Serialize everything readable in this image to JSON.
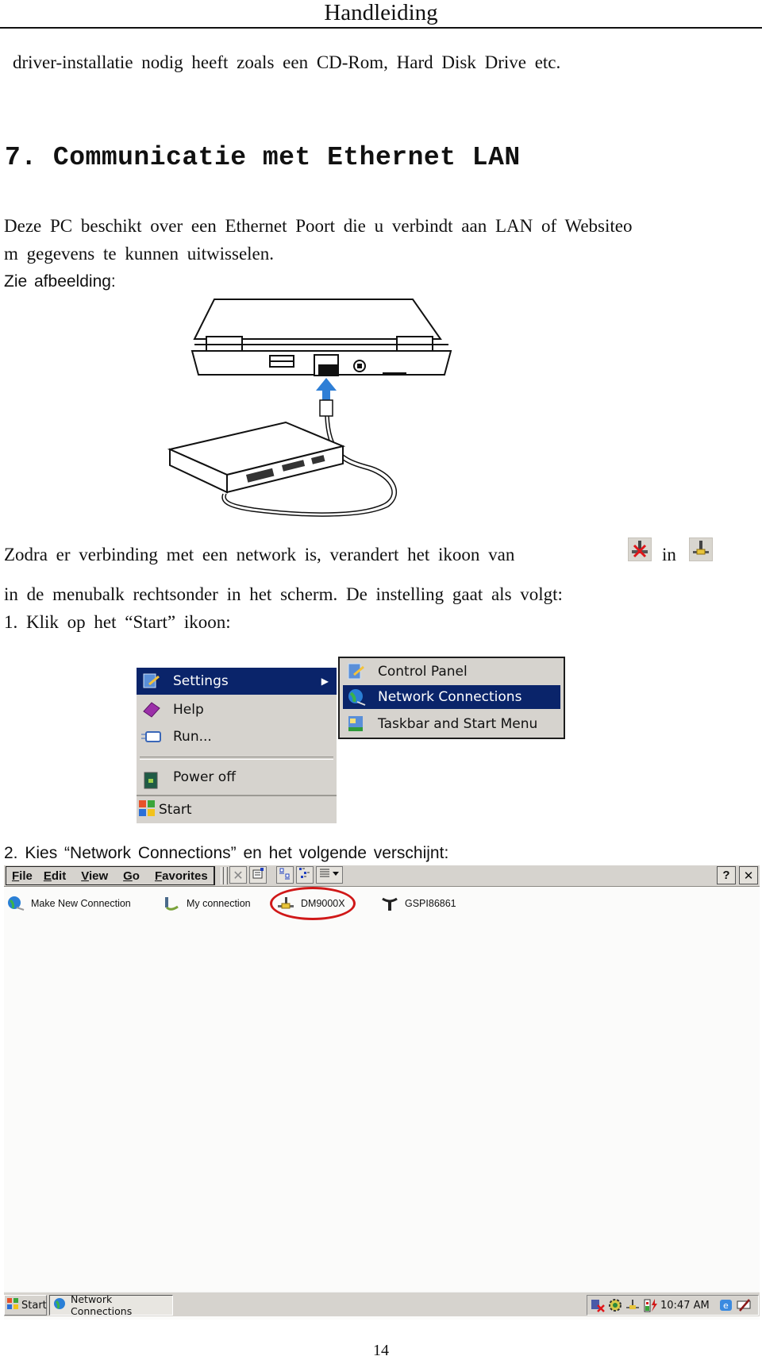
{
  "running_header": "Handleiding",
  "page_number": "14",
  "paragraphs": {
    "p_continuation": "driver-installatie nodig heeft zoals een CD-Rom, Hard Disk Drive etc.",
    "section_heading": "7. Communicatie met Ethernet LAN",
    "p_intro_line1": "Deze PC beschikt over een Ethernet Poort die u verbindt aan LAN of Websiteo",
    "p_intro_line2": "m gegevens te kunnen uitwisselen.",
    "see_figure": "Zie afbeelding:",
    "p_icon_line1_a": "Zodra er verbinding met een network is, verandert het ikoon van",
    "p_icon_line1_b": "in",
    "p_icon_line2": "in de menubalk rechtsonder in het scherm. De instelling gaat als volgt:",
    "step1": "1. Klik op het “Start” ikoon:",
    "step2": "2. Kies “Network Connections” en het volgende verschijnt:"
  },
  "figure": {
    "description": "laptop-ethernet-connection-illustration",
    "arrow_color": "#2f7fd6"
  },
  "inline_icons": {
    "disconnected": "network-disconnected-icon",
    "connected": "network-connected-icon"
  },
  "start_menu": {
    "items": [
      {
        "label": "Settings",
        "icon": "settings-icon",
        "selected": true,
        "has_submenu": true
      },
      {
        "label": "Help",
        "icon": "help-book-icon",
        "selected": false
      },
      {
        "label": "Run...",
        "icon": "run-icon",
        "selected": false
      },
      {
        "label": "Power off",
        "icon": "power-off-icon",
        "selected": false
      }
    ],
    "start_label": "Start",
    "submenu": [
      {
        "label": "Control Panel",
        "icon": "control-panel-icon",
        "selected": false
      },
      {
        "label": "Network Connections",
        "icon": "network-connections-icon",
        "selected": true
      },
      {
        "label": "Taskbar and Start Menu",
        "icon": "taskbar-icon",
        "selected": false
      }
    ],
    "highlight_color": "#0a246a"
  },
  "explorer": {
    "menu": [
      {
        "label": "File",
        "mnemonic": "F",
        "rest": "ile"
      },
      {
        "label": "Edit",
        "mnemonic": "E",
        "rest": "dit"
      },
      {
        "label": "View",
        "mnemonic": "V",
        "rest": "iew"
      },
      {
        "label": "Go",
        "mnemonic": "G",
        "rest": "o"
      },
      {
        "label": "Favorites",
        "mnemonic": "F",
        "rest": "avorites"
      }
    ],
    "toolbar": [
      "delete-icon",
      "properties-icon",
      "large-icons-view-icon",
      "small-icons-view-icon",
      "details-view-icon"
    ],
    "window_buttons": {
      "help": "?",
      "close": "✕"
    },
    "connections": [
      {
        "label": "Make New Connection",
        "icon": "make-new-connection-icon"
      },
      {
        "label": "My connection",
        "icon": "dialup-connection-icon"
      },
      {
        "label": "DM9000X",
        "icon": "ethernet-connection-icon",
        "highlighted": true
      },
      {
        "label": "GSPI86861",
        "icon": "wireless-connection-icon"
      }
    ],
    "highlight_circle_color": "#d01818",
    "taskbar": {
      "start_label": "Start",
      "task_label": "Network Connections",
      "clock": "10:47 AM",
      "tray_icons": [
        "network-disconnected-tray-icon",
        "settings-gear-tray-icon",
        "ethernet-connected-tray-icon",
        "battery-charging-tray-icon",
        "ie-tray-icon",
        "input-panel-tray-icon"
      ]
    }
  }
}
